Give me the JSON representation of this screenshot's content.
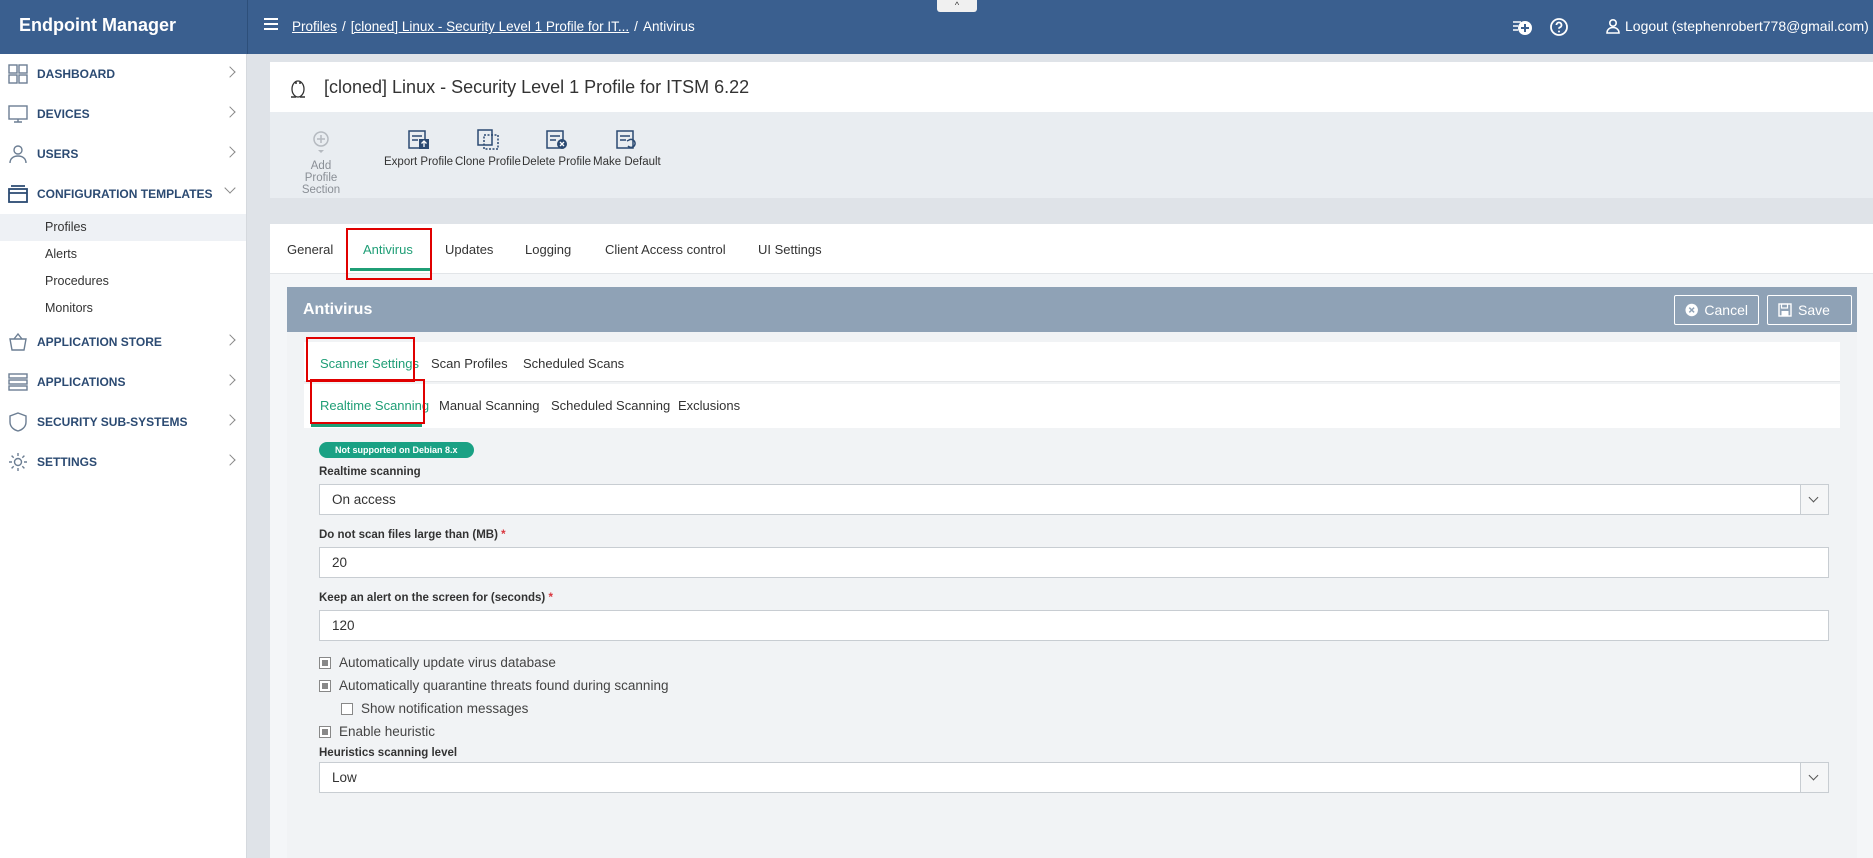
{
  "app": {
    "title": "Endpoint Manager"
  },
  "header": {
    "breadcrumb": [
      "Profiles",
      "[cloned] Linux - Security Level 1 Profile for IT...",
      "Antivirus"
    ],
    "collapse_glyph": "^",
    "logout_label": "Logout (stephenrobert778@gmail.com)"
  },
  "sidebar": {
    "items": [
      {
        "label": "DASHBOARD",
        "icon": "dashboard-icon"
      },
      {
        "label": "DEVICES",
        "icon": "devices-icon"
      },
      {
        "label": "USERS",
        "icon": "user-icon"
      },
      {
        "label": "CONFIGURATION TEMPLATES",
        "icon": "templates-icon",
        "expanded": true,
        "children": [
          "Profiles",
          "Alerts",
          "Procedures",
          "Monitors"
        ]
      },
      {
        "label": "APPLICATION STORE",
        "icon": "store-icon"
      },
      {
        "label": "APPLICATIONS",
        "icon": "applications-icon"
      },
      {
        "label": "SECURITY SUB-SYSTEMS",
        "icon": "shield-icon"
      },
      {
        "label": "SETTINGS",
        "icon": "gear-icon"
      }
    ]
  },
  "profile": {
    "title": "[cloned] Linux - Security Level 1 Profile for ITSM 6.22",
    "toolbar": {
      "add_section": "Add Profile Section",
      "export": "Export Profile",
      "clone": "Clone Profile",
      "delete": "Delete Profile",
      "make_default": "Make Default"
    },
    "tabs": [
      "General",
      "Antivirus",
      "Updates",
      "Logging",
      "Client Access control",
      "UI Settings"
    ]
  },
  "antivirus": {
    "title": "Antivirus",
    "cancel_label": "Cancel",
    "save_label": "Save",
    "section_tabs": [
      "Scanner Settings",
      "Scan Profiles",
      "Scheduled Scans"
    ],
    "scan_tabs": [
      "Realtime Scanning",
      "Manual Scanning",
      "Scheduled Scanning",
      "Exclusions"
    ],
    "badge": "Not supported on Debian 8.x",
    "realtime_label": "Realtime scanning",
    "realtime_value": "On access",
    "max_size_label": "Do not scan files large than (MB)",
    "max_size_value": "20",
    "alert_label": "Keep an alert on the screen for (seconds)",
    "alert_value": "120",
    "required_mark": "*",
    "checkboxes": [
      {
        "label": "Automatically update virus database",
        "checked": true
      },
      {
        "label": "Automatically quarantine threats found during scanning",
        "checked": true
      },
      {
        "label": "Show notification messages",
        "checked": false
      },
      {
        "label": "Enable heuristic",
        "checked": true
      }
    ],
    "heuristics_label": "Heuristics scanning level",
    "heuristics_value": "Low"
  },
  "colors": {
    "header": "#3a5f8f",
    "accent": "#1f9e76",
    "highlight": "#e00000"
  }
}
